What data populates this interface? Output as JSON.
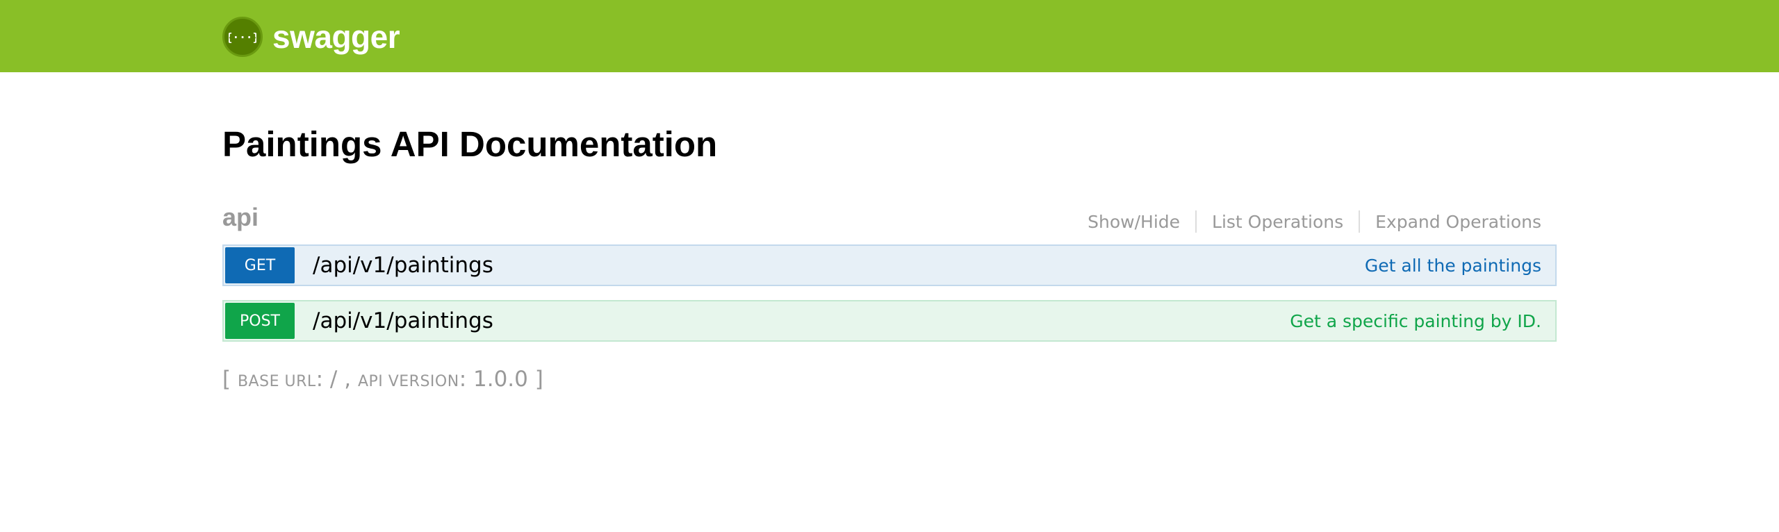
{
  "header": {
    "logo_glyph": "{···}",
    "logo_text": "swagger",
    "accent_color": "#89bf27"
  },
  "page": {
    "title": "Paintings API Documentation"
  },
  "resource": {
    "name": "api",
    "options": {
      "show_hide": "Show/Hide",
      "list_operations": "List Operations",
      "expand_operations": "Expand Operations"
    },
    "operations": [
      {
        "method": "GET",
        "path": "/api/v1/paintings",
        "summary": "Get all the paintings",
        "color": "#0f6ab4"
      },
      {
        "method": "POST",
        "path": "/api/v1/paintings",
        "summary": "Get a specific painting by ID.",
        "color": "#10a54a"
      }
    ]
  },
  "footer": {
    "open_bracket": "[",
    "base_url_label": "BASE URL",
    "base_url_value": ": / , ",
    "api_version_label": "API VERSION",
    "api_version_value": ": 1.0.0 ",
    "close_bracket": "]"
  }
}
